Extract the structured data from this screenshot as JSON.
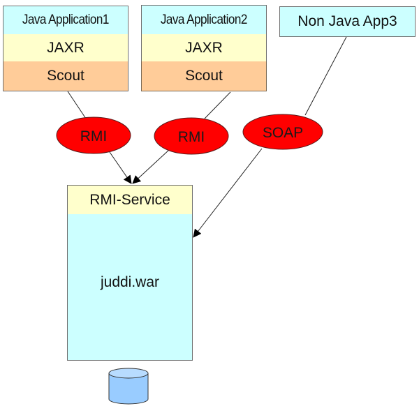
{
  "diagram": {
    "clients": [
      {
        "title": "Java Application1",
        "layers": [
          "JAXR",
          "Scout"
        ]
      },
      {
        "title": "Java Application2",
        "layers": [
          "JAXR",
          "Scout"
        ]
      },
      {
        "title": "Non Java App3",
        "layers": []
      }
    ],
    "protocols": [
      "RMI",
      "RMI",
      "SOAP"
    ],
    "server": {
      "service_label": "RMI-Service",
      "war_label": "juddi.war"
    },
    "database": {
      "icon": "database-cylinder-icon"
    },
    "colors": {
      "app_header": "#ccffff",
      "jaxr_layer": "#ffffcc",
      "scout_layer": "#ffcc99",
      "protocol_ellipse": "#ff0000",
      "service_header": "#ffffcc",
      "war_body": "#ccffff",
      "database": "#99ccff"
    }
  }
}
